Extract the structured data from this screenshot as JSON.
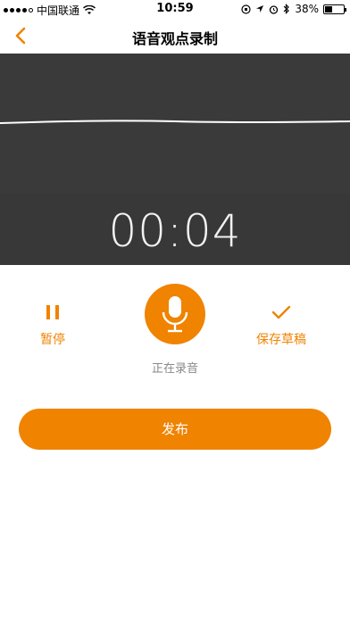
{
  "status_bar": {
    "carrier": "中国联通",
    "time": "10:59",
    "battery": "38%",
    "battery_level": 0.38
  },
  "nav": {
    "title": "语音观点录制"
  },
  "recorder": {
    "timer": "00:04"
  },
  "controls": {
    "pause_label": "暂停",
    "save_label": "保存草稿",
    "status_text": "正在录音"
  },
  "actions": {
    "publish_label": "发布"
  },
  "colors": {
    "accent": "#f08300",
    "dark_bg": "#3a3a3a"
  },
  "icons": {
    "back": "chevron-left-icon",
    "pause": "pause-icon",
    "mic": "microphone-icon",
    "save": "checkmark-icon"
  }
}
